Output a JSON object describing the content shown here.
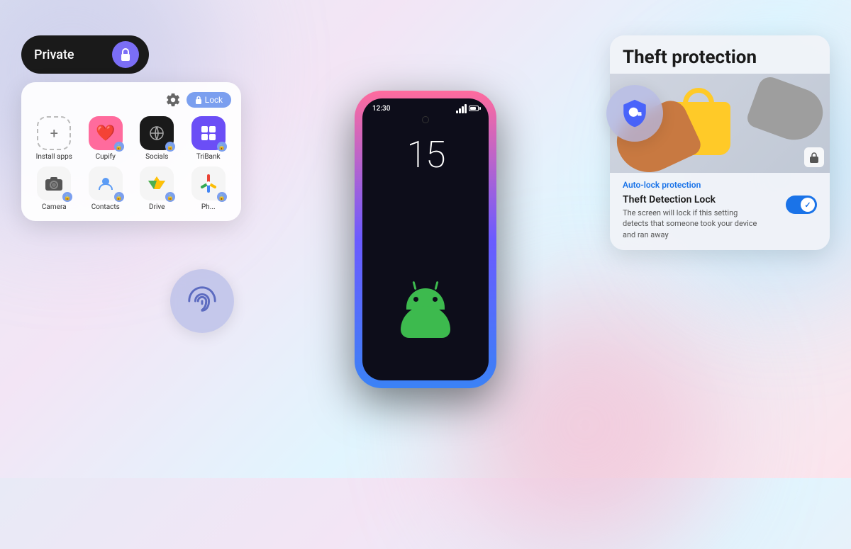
{
  "background": {
    "gradient": "linear-gradient(135deg, #e8eaf6 0%, #f3e5f5 30%, #e1f5fe 60%, #fce4ec 100%)"
  },
  "phone": {
    "time": "12:30",
    "clock_number": "15",
    "android_version": "Android 15"
  },
  "left_panel": {
    "private_label": "Private",
    "lock_button_label": "Lock",
    "grid_top_row": [
      {
        "id": "install",
        "label": "Install apps",
        "icon": "+"
      },
      {
        "id": "cupify",
        "label": "Cupify",
        "icon": "❤"
      },
      {
        "id": "socials",
        "label": "Socials",
        "icon": "⟲"
      },
      {
        "id": "tribank",
        "label": "TriBank",
        "icon": "⬡"
      }
    ],
    "grid_bottom_row": [
      {
        "id": "camera",
        "label": "Camera",
        "icon": "📷"
      },
      {
        "id": "contacts",
        "label": "Contacts",
        "icon": "👤"
      },
      {
        "id": "drive",
        "label": "Drive",
        "icon": "△"
      },
      {
        "id": "photos",
        "label": "Ph...",
        "icon": "🌸"
      }
    ]
  },
  "right_panel": {
    "title": "Theft protection",
    "auto_lock_label": "Auto-lock protection",
    "feature_name": "Theft Detection Lock",
    "feature_desc": "The screen will lock if this setting detects that someone took your device and ran away",
    "toggle_state": "on"
  },
  "fingerprint_bubble": {
    "aria": "fingerprint-icon"
  },
  "key_shield_bubble": {
    "aria": "key-shield-icon"
  }
}
